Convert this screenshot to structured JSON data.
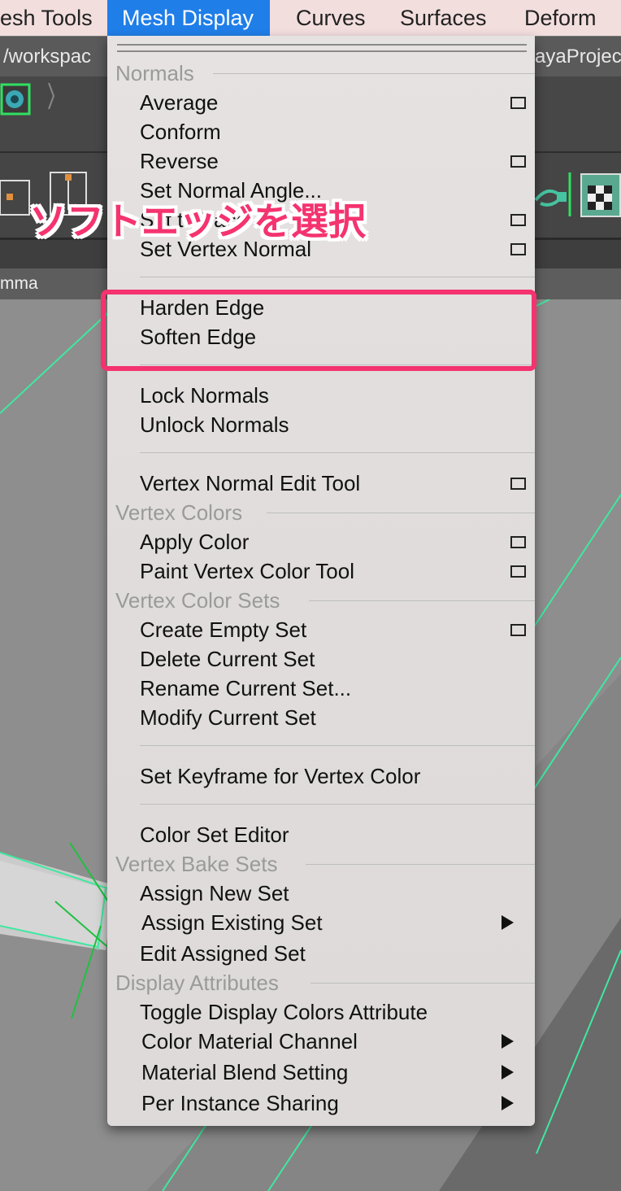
{
  "menubar": {
    "items": [
      "esh Tools",
      "Mesh Display",
      "Curves",
      "Surfaces",
      "Deform"
    ]
  },
  "pathbar": {
    "left": "/workspac",
    "right": "ayaProjec"
  },
  "panel": {
    "label": "mma"
  },
  "menu": {
    "tear_off": "tear-off-handle",
    "normals_header": "Normals",
    "normals": {
      "average": "Average",
      "conform": "Conform",
      "reverse": "Reverse",
      "set_normal_angle": "Set Normal Angle...",
      "set_to_face": "Set to Face",
      "set_vertex_normal": "Set Vertex Normal",
      "harden_edge": "Harden Edge",
      "soften_edge": "Soften Edge",
      "lock_normals": "Lock Normals",
      "unlock_normals": "Unlock Normals",
      "vertex_normal_edit_tool": "Vertex Normal Edit Tool"
    },
    "vertex_colors_header": "Vertex Colors",
    "vertex_colors": {
      "apply_color": "Apply Color",
      "paint_vertex_color_tool": "Paint Vertex Color Tool"
    },
    "vertex_color_sets_header": "Vertex Color Sets",
    "vertex_color_sets": {
      "create_empty_set": "Create Empty Set",
      "delete_current_set": "Delete Current Set",
      "rename_current_set": "Rename Current Set...",
      "modify_current_set": "Modify Current Set",
      "set_keyframe": "Set Keyframe for Vertex Color",
      "color_set_editor": "Color Set Editor"
    },
    "vertex_bake_sets_header": "Vertex Bake Sets",
    "vertex_bake_sets": {
      "assign_new_set": "Assign New Set",
      "assign_existing_set": "Assign Existing Set",
      "edit_assigned_set": "Edit Assigned Set"
    },
    "display_attributes_header": "Display Attributes",
    "display_attributes": {
      "toggle_display_colors": "Toggle Display Colors Attribute",
      "color_material_channel": "Color Material Channel",
      "material_blend_setting": "Material Blend Setting",
      "per_instance_sharing": "Per Instance Sharing"
    }
  },
  "annotation": {
    "text": "ソフトエッジを選択"
  },
  "colors": {
    "accent": "#1f7ee8",
    "highlight": "#f4336f",
    "wireframe": "#3fe8a0"
  }
}
